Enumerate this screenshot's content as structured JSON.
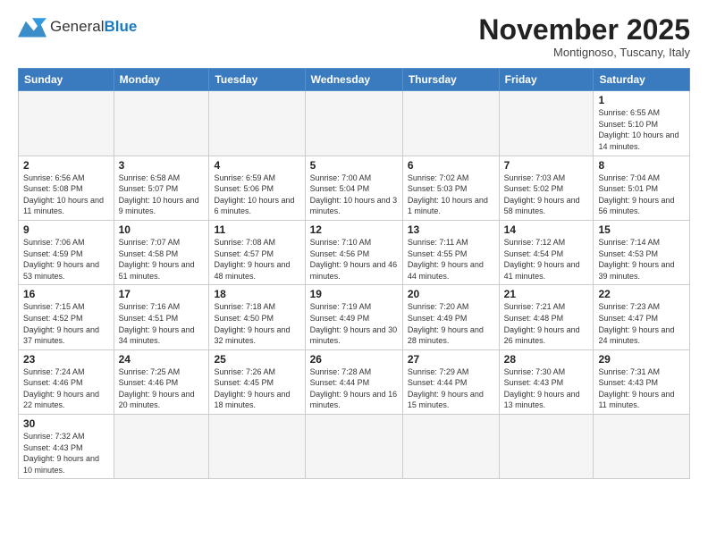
{
  "header": {
    "logo": {
      "general": "General",
      "blue": "Blue"
    },
    "title": "November 2025",
    "location": "Montignoso, Tuscany, Italy"
  },
  "days_of_week": [
    "Sunday",
    "Monday",
    "Tuesday",
    "Wednesday",
    "Thursday",
    "Friday",
    "Saturday"
  ],
  "weeks": [
    [
      {
        "day": "",
        "info": ""
      },
      {
        "day": "",
        "info": ""
      },
      {
        "day": "",
        "info": ""
      },
      {
        "day": "",
        "info": ""
      },
      {
        "day": "",
        "info": ""
      },
      {
        "day": "",
        "info": ""
      },
      {
        "day": "1",
        "info": "Sunrise: 6:55 AM\nSunset: 5:10 PM\nDaylight: 10 hours\nand 14 minutes."
      }
    ],
    [
      {
        "day": "2",
        "info": "Sunrise: 6:56 AM\nSunset: 5:08 PM\nDaylight: 10 hours\nand 11 minutes."
      },
      {
        "day": "3",
        "info": "Sunrise: 6:58 AM\nSunset: 5:07 PM\nDaylight: 10 hours\nand 9 minutes."
      },
      {
        "day": "4",
        "info": "Sunrise: 6:59 AM\nSunset: 5:06 PM\nDaylight: 10 hours\nand 6 minutes."
      },
      {
        "day": "5",
        "info": "Sunrise: 7:00 AM\nSunset: 5:04 PM\nDaylight: 10 hours\nand 3 minutes."
      },
      {
        "day": "6",
        "info": "Sunrise: 7:02 AM\nSunset: 5:03 PM\nDaylight: 10 hours\nand 1 minute."
      },
      {
        "day": "7",
        "info": "Sunrise: 7:03 AM\nSunset: 5:02 PM\nDaylight: 9 hours\nand 58 minutes."
      },
      {
        "day": "8",
        "info": "Sunrise: 7:04 AM\nSunset: 5:01 PM\nDaylight: 9 hours\nand 56 minutes."
      }
    ],
    [
      {
        "day": "9",
        "info": "Sunrise: 7:06 AM\nSunset: 4:59 PM\nDaylight: 9 hours\nand 53 minutes."
      },
      {
        "day": "10",
        "info": "Sunrise: 7:07 AM\nSunset: 4:58 PM\nDaylight: 9 hours\nand 51 minutes."
      },
      {
        "day": "11",
        "info": "Sunrise: 7:08 AM\nSunset: 4:57 PM\nDaylight: 9 hours\nand 48 minutes."
      },
      {
        "day": "12",
        "info": "Sunrise: 7:10 AM\nSunset: 4:56 PM\nDaylight: 9 hours\nand 46 minutes."
      },
      {
        "day": "13",
        "info": "Sunrise: 7:11 AM\nSunset: 4:55 PM\nDaylight: 9 hours\nand 44 minutes."
      },
      {
        "day": "14",
        "info": "Sunrise: 7:12 AM\nSunset: 4:54 PM\nDaylight: 9 hours\nand 41 minutes."
      },
      {
        "day": "15",
        "info": "Sunrise: 7:14 AM\nSunset: 4:53 PM\nDaylight: 9 hours\nand 39 minutes."
      }
    ],
    [
      {
        "day": "16",
        "info": "Sunrise: 7:15 AM\nSunset: 4:52 PM\nDaylight: 9 hours\nand 37 minutes."
      },
      {
        "day": "17",
        "info": "Sunrise: 7:16 AM\nSunset: 4:51 PM\nDaylight: 9 hours\nand 34 minutes."
      },
      {
        "day": "18",
        "info": "Sunrise: 7:18 AM\nSunset: 4:50 PM\nDaylight: 9 hours\nand 32 minutes."
      },
      {
        "day": "19",
        "info": "Sunrise: 7:19 AM\nSunset: 4:49 PM\nDaylight: 9 hours\nand 30 minutes."
      },
      {
        "day": "20",
        "info": "Sunrise: 7:20 AM\nSunset: 4:49 PM\nDaylight: 9 hours\nand 28 minutes."
      },
      {
        "day": "21",
        "info": "Sunrise: 7:21 AM\nSunset: 4:48 PM\nDaylight: 9 hours\nand 26 minutes."
      },
      {
        "day": "22",
        "info": "Sunrise: 7:23 AM\nSunset: 4:47 PM\nDaylight: 9 hours\nand 24 minutes."
      }
    ],
    [
      {
        "day": "23",
        "info": "Sunrise: 7:24 AM\nSunset: 4:46 PM\nDaylight: 9 hours\nand 22 minutes."
      },
      {
        "day": "24",
        "info": "Sunrise: 7:25 AM\nSunset: 4:46 PM\nDaylight: 9 hours\nand 20 minutes."
      },
      {
        "day": "25",
        "info": "Sunrise: 7:26 AM\nSunset: 4:45 PM\nDaylight: 9 hours\nand 18 minutes."
      },
      {
        "day": "26",
        "info": "Sunrise: 7:28 AM\nSunset: 4:44 PM\nDaylight: 9 hours\nand 16 minutes."
      },
      {
        "day": "27",
        "info": "Sunrise: 7:29 AM\nSunset: 4:44 PM\nDaylight: 9 hours\nand 15 minutes."
      },
      {
        "day": "28",
        "info": "Sunrise: 7:30 AM\nSunset: 4:43 PM\nDaylight: 9 hours\nand 13 minutes."
      },
      {
        "day": "29",
        "info": "Sunrise: 7:31 AM\nSunset: 4:43 PM\nDaylight: 9 hours\nand 11 minutes."
      }
    ],
    [
      {
        "day": "30",
        "info": "Sunrise: 7:32 AM\nSunset: 4:43 PM\nDaylight: 9 hours\nand 10 minutes."
      },
      {
        "day": "",
        "info": ""
      },
      {
        "day": "",
        "info": ""
      },
      {
        "day": "",
        "info": ""
      },
      {
        "day": "",
        "info": ""
      },
      {
        "day": "",
        "info": ""
      },
      {
        "day": "",
        "info": ""
      }
    ]
  ]
}
